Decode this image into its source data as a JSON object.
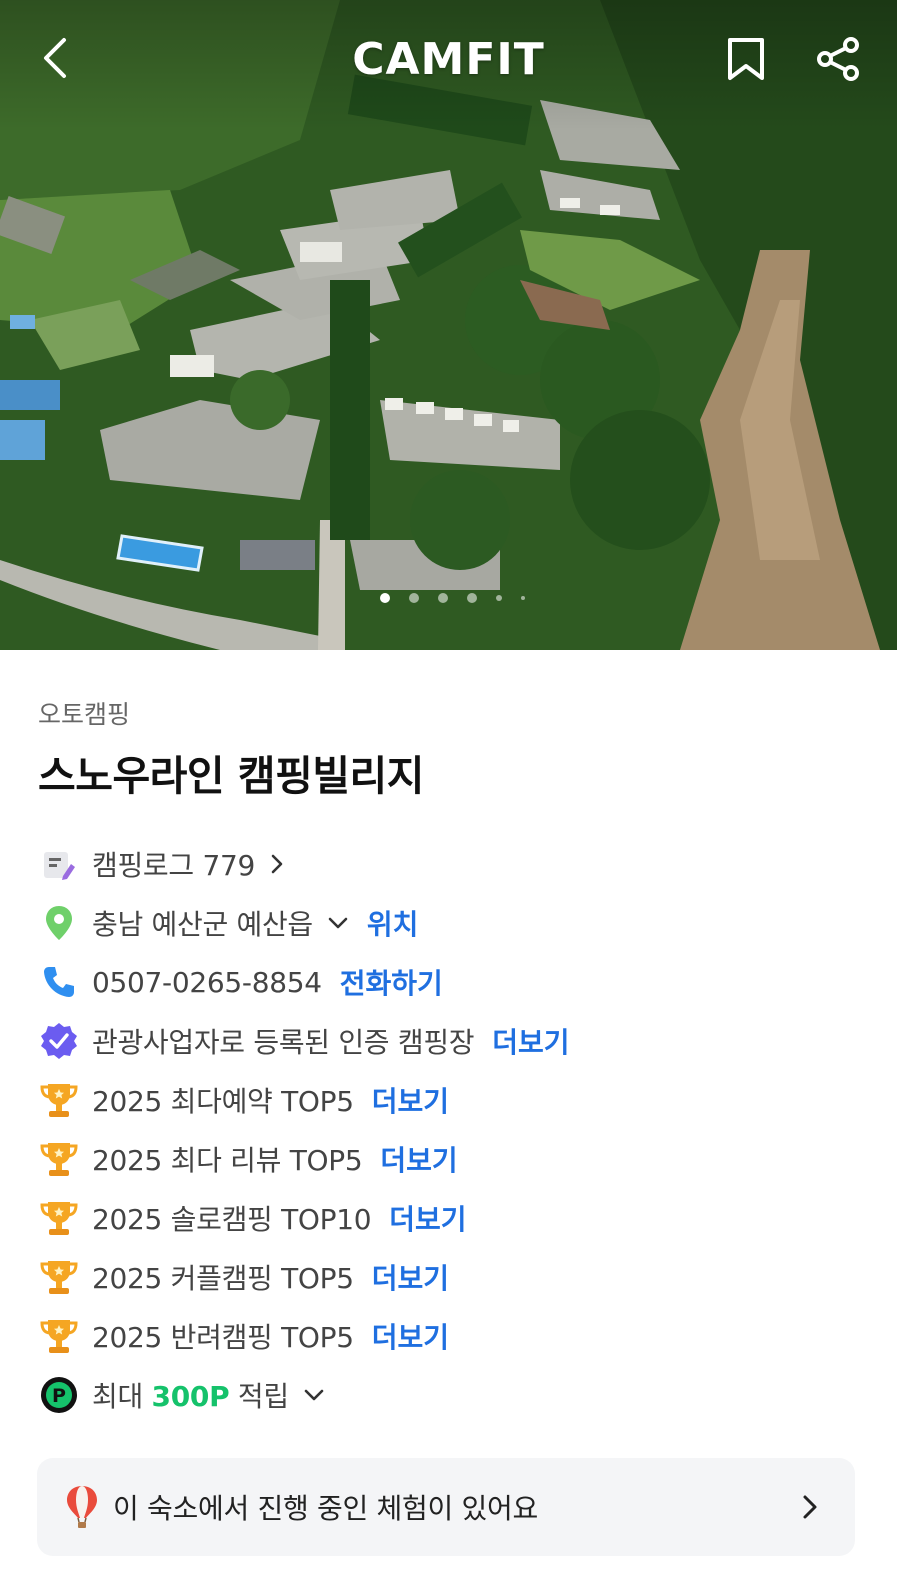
{
  "header": {
    "logo_text": "CAMFIT",
    "icons": [
      "back-arrow-icon",
      "bookmark-icon",
      "share-icon"
    ]
  },
  "hero": {
    "image_description": "aerial-photo-campground",
    "carousel": {
      "current_index": 1,
      "dot_count": 6
    }
  },
  "place": {
    "category": "오토캠핑",
    "name": "스노우라인 캠핑빌리지"
  },
  "info": {
    "camplog": {
      "text": "캠핑로그 779"
    },
    "location": {
      "text": "충남 예산군 예산읍",
      "link": "위치"
    },
    "phone": {
      "text": "0507-0265-8854",
      "link": "전화하기"
    },
    "certified": {
      "text": "관광사업자로 등록된 인증 캠핑장",
      "link": "더보기"
    },
    "awards": [
      {
        "text": "2025 최다예약 TOP5",
        "link": "더보기"
      },
      {
        "text": "2025 최다 리뷰 TOP5",
        "link": "더보기"
      },
      {
        "text": "2025 솔로캠핑 TOP10",
        "link": "더보기"
      },
      {
        "text": "2025 커플캠핑 TOP5",
        "link": "더보기"
      },
      {
        "text": "2025 반려캠핑 TOP5",
        "link": "더보기"
      }
    ],
    "points": {
      "prefix": "최대 ",
      "amount": "300P",
      "suffix": " 적립"
    }
  },
  "banner": {
    "text": "이 숙소에서 진행 중인 체험이 있어요"
  },
  "colors": {
    "link": "#1f6fe0",
    "points_green": "#15c26b",
    "trophy": "#f5a623",
    "verify_purple": "#6b5cf0"
  }
}
